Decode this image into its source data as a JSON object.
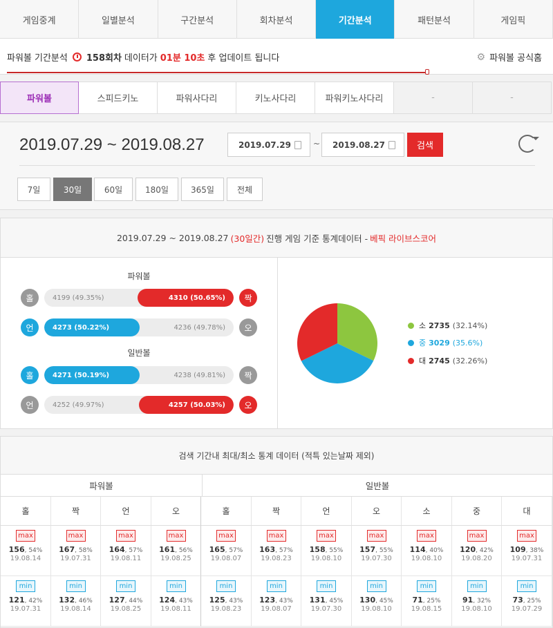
{
  "tabs": [
    "게임중계",
    "일별분석",
    "구간분석",
    "회차분석",
    "기간분석",
    "패턴분석",
    "게임픽"
  ],
  "active_tab": 4,
  "info": {
    "prefix": "파워볼 기간분석",
    "round": "158회차",
    "mid": "데이터가",
    "time": "01분 10초",
    "suffix": "후 업데이트 됩니다",
    "official": "파워볼 공식홈",
    "progress": 0.76
  },
  "game_tabs": [
    "파워볼",
    "스피드키노",
    "파워사다리",
    "키노사다리",
    "파워키노사다리",
    "-",
    "-"
  ],
  "date": {
    "range_text": "2019.07.29 ~ 2019.08.27",
    "start": "2019.07.29",
    "tilde": "~",
    "end": "2019.08.27",
    "search_label": "검색",
    "periods": [
      "7일",
      "30일",
      "60일",
      "180일",
      "365일",
      "전체"
    ],
    "active_period": 1
  },
  "stats": {
    "header_range": "2019.07.29 ~ 2019.08.27",
    "header_days": "(30일간)",
    "header_text": "진행 게임 기준 통계데이터 -",
    "header_brand": "베픽 라이브스코어",
    "powerball_title": "파워볼",
    "normal_title": "일반볼",
    "rows": [
      {
        "left": "홀",
        "right": "짝",
        "left_text": "4199 (49.35%)",
        "right_text": "4310 (50.65%)",
        "left_pct": 49.35,
        "right_pct": 50.65,
        "winner": "right",
        "left_color": "gray",
        "right_color": "red"
      },
      {
        "left": "언",
        "right": "오",
        "left_text": "4273 (50.22%)",
        "right_text": "4236 (49.78%)",
        "left_pct": 50.22,
        "right_pct": 49.78,
        "winner": "left",
        "left_color": "blue",
        "right_color": "gray"
      },
      {
        "left": "홀",
        "right": "짝",
        "left_text": "4271 (50.19%)",
        "right_text": "4238 (49.81%)",
        "left_pct": 50.19,
        "right_pct": 49.81,
        "winner": "left",
        "left_color": "blue",
        "right_color": "gray"
      },
      {
        "left": "언",
        "right": "오",
        "left_text": "4252 (49.97%)",
        "right_text": "4257 (50.03%)",
        "left_pct": 49.97,
        "right_pct": 50.03,
        "winner": "right",
        "left_color": "gray",
        "right_color": "red"
      }
    ],
    "pie": [
      {
        "label": "소",
        "count": "2735",
        "pct": "(32.14%)",
        "value": 32.14,
        "color": "#8dc63f"
      },
      {
        "label": "중",
        "count": "3029",
        "pct": "(35.6%)",
        "value": 35.6,
        "color": "#1ea7dd"
      },
      {
        "label": "대",
        "count": "2745",
        "pct": "(32.26%)",
        "value": 32.26,
        "color": "#e32a2a"
      }
    ]
  },
  "minmax": {
    "header": "검색 기간내 최대/최소 통계 데이터 (적특 있는날짜 제외)",
    "group_powerball": "파워볼",
    "group_normal": "일반볼",
    "max_label": "max",
    "min_label": "min",
    "columns": [
      {
        "h": "홀",
        "max": {
          "v": "156",
          "p": ", 54%",
          "d": "19.08.14"
        },
        "min": {
          "v": "121",
          "p": ", 42%",
          "d": "19.07.31"
        }
      },
      {
        "h": "짝",
        "max": {
          "v": "167",
          "p": ", 58%",
          "d": "19.07.31"
        },
        "min": {
          "v": "132",
          "p": ", 46%",
          "d": "19.08.14"
        }
      },
      {
        "h": "언",
        "max": {
          "v": "164",
          "p": ", 57%",
          "d": "19.08.11"
        },
        "min": {
          "v": "127",
          "p": ", 44%",
          "d": "19.08.25"
        }
      },
      {
        "h": "오",
        "max": {
          "v": "161",
          "p": ", 56%",
          "d": "19.08.25"
        },
        "min": {
          "v": "124",
          "p": ", 43%",
          "d": "19.08.11"
        }
      },
      {
        "h": "홀",
        "max": {
          "v": "165",
          "p": ", 57%",
          "d": "19.08.07"
        },
        "min": {
          "v": "125",
          "p": ", 43%",
          "d": "19.08.23"
        }
      },
      {
        "h": "짝",
        "max": {
          "v": "163",
          "p": ", 57%",
          "d": "19.08.23"
        },
        "min": {
          "v": "123",
          "p": ", 43%",
          "d": "19.08.07"
        }
      },
      {
        "h": "언",
        "max": {
          "v": "158",
          "p": ", 55%",
          "d": "19.08.10"
        },
        "min": {
          "v": "131",
          "p": ", 45%",
          "d": "19.07.30"
        }
      },
      {
        "h": "오",
        "max": {
          "v": "157",
          "p": ", 55%",
          "d": "19.07.30"
        },
        "min": {
          "v": "130",
          "p": ", 45%",
          "d": "19.08.10"
        }
      },
      {
        "h": "소",
        "max": {
          "v": "114",
          "p": ", 40%",
          "d": "19.08.10"
        },
        "min": {
          "v": "71",
          "p": ", 25%",
          "d": "19.08.15"
        }
      },
      {
        "h": "중",
        "max": {
          "v": "120",
          "p": ", 42%",
          "d": "19.08.20"
        },
        "min": {
          "v": "91",
          "p": ", 32%",
          "d": "19.08.10"
        }
      },
      {
        "h": "대",
        "max": {
          "v": "109",
          "p": ", 38%",
          "d": "19.07.31"
        },
        "min": {
          "v": "73",
          "p": ", 25%",
          "d": "19.07.29"
        }
      }
    ]
  }
}
